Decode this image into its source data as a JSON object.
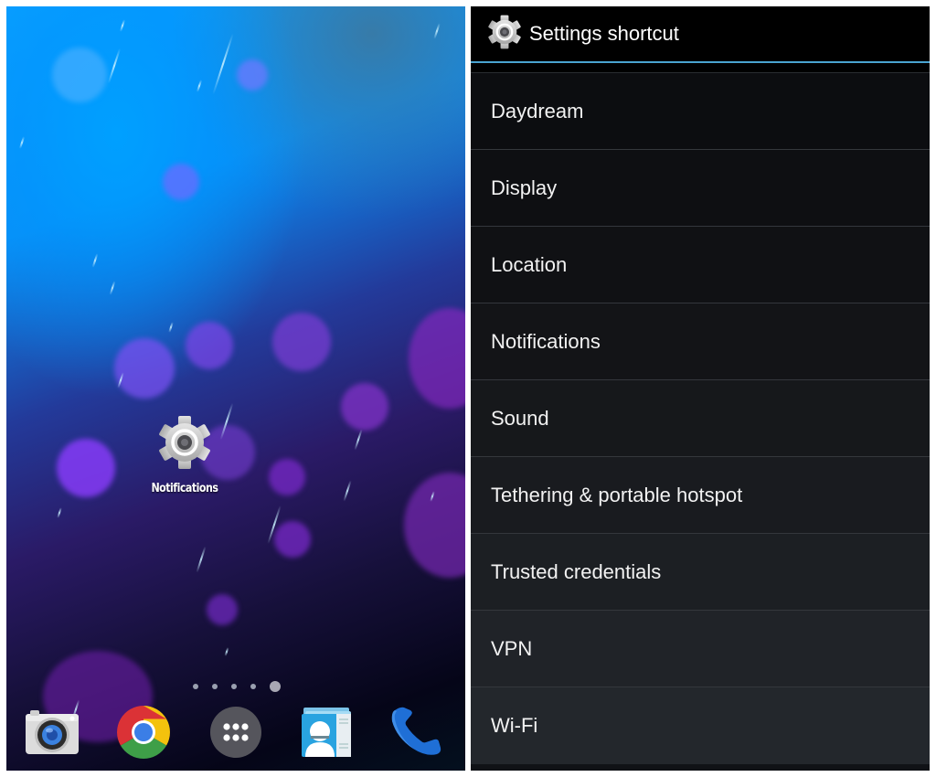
{
  "home_screen": {
    "shortcut": {
      "label": "Notifications",
      "icon": "settings-gear-icon"
    },
    "page_indicator": {
      "page_count": 5,
      "active_page": 5
    },
    "dock": [
      {
        "name": "camera",
        "icon": "camera-icon"
      },
      {
        "name": "chrome",
        "icon": "chrome-icon"
      },
      {
        "name": "all-apps",
        "icon": "app-drawer-icon"
      },
      {
        "name": "contacts",
        "icon": "contacts-icon"
      },
      {
        "name": "phone",
        "icon": "phone-icon"
      }
    ]
  },
  "settings_shortcut": {
    "title": "Settings shortcut",
    "title_icon": "settings-gear-icon",
    "accent_color": "#4aa3d0",
    "items": [
      {
        "label": "Daydream"
      },
      {
        "label": "Display"
      },
      {
        "label": "Location"
      },
      {
        "label": "Notifications"
      },
      {
        "label": "Sound"
      },
      {
        "label": "Tethering & portable hotspot"
      },
      {
        "label": "Trusted credentials"
      },
      {
        "label": "VPN"
      },
      {
        "label": "Wi-Fi"
      }
    ]
  }
}
